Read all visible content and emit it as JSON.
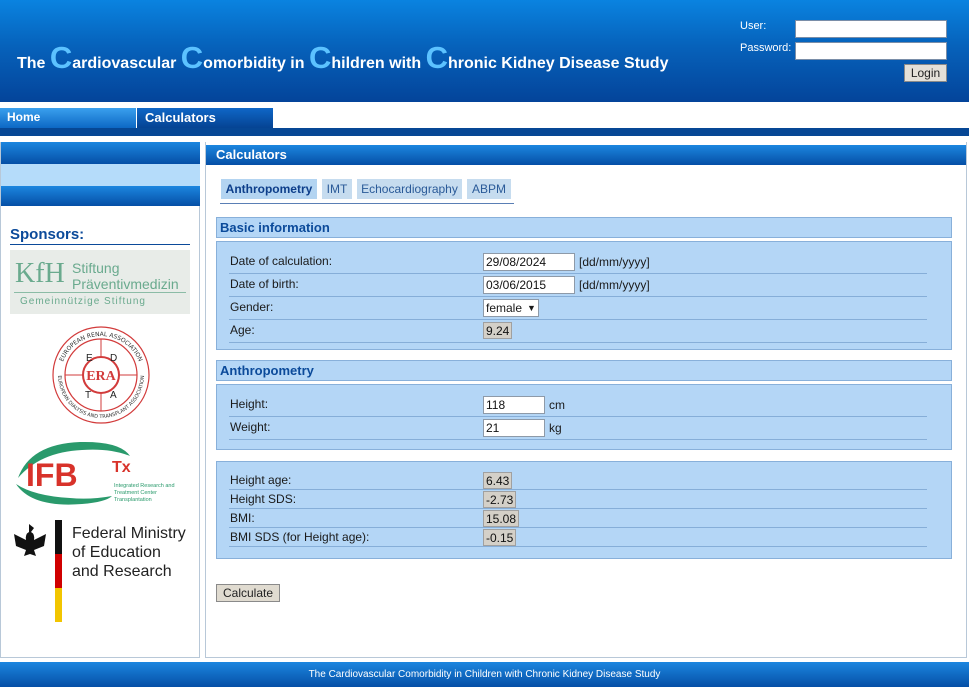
{
  "header": {
    "title_parts": {
      "p1": "The ",
      "c1": "C",
      "p2": "ardiovascular ",
      "c2": "C",
      "p3": "omorbidity in ",
      "c3": "C",
      "p4": "hildren with ",
      "c4": "C",
      "p5": "hronic Kidney Disease Study"
    },
    "user_label": "User:",
    "password_label": "Password:",
    "user_value": "",
    "password_value": "",
    "login_label": "Login"
  },
  "nav": {
    "home": "Home",
    "calculators": "Calculators"
  },
  "sidebar": {
    "sponsors_title": "Sponsors:",
    "kfh": {
      "mark": "KfH",
      "line1": "Stiftung",
      "line2": "Präventivmedizin",
      "line3": "Gemeinnützige Stiftung"
    },
    "era": {
      "ring_top": "EUROPEAN RENAL ASSOCIATION",
      "ring_bottom": "EUROPEAN DIALYSIS AND TRANSPLANT ASSOCIATION",
      "center": "ERA",
      "letters": [
        "E",
        "D",
        "T",
        "A"
      ]
    },
    "ifb": {
      "mark": "IFB",
      "sub": "Tx",
      "line1": "Integrated Research and",
      "line2": "Treatment Center",
      "line3": "Transplantation"
    },
    "bmbf": {
      "line1": "Federal Ministry",
      "line2": "of Education",
      "line3": "and Research"
    }
  },
  "main": {
    "title": "Calculators",
    "tabs": [
      {
        "label": "Anthropometry",
        "active": true
      },
      {
        "label": "IMT",
        "active": false
      },
      {
        "label": "Echocardiography",
        "active": false
      },
      {
        "label": "ABPM",
        "active": false
      }
    ],
    "basic": {
      "title": "Basic information",
      "date_calc_label": "Date of calculation:",
      "date_calc_value": "29/08/2024",
      "date_calc_unit": "[dd/mm/yyyy]",
      "dob_label": "Date of birth:",
      "dob_value": "03/06/2015",
      "dob_unit": "[dd/mm/yyyy]",
      "gender_label": "Gender:",
      "gender_value": "female",
      "age_label": "Age:",
      "age_value": "9.24"
    },
    "anthro": {
      "title": "Anthropometry",
      "height_label": "Height:",
      "height_value": "118",
      "height_unit": "cm",
      "weight_label": "Weight:",
      "weight_value": "21",
      "weight_unit": "kg"
    },
    "results": {
      "height_age_label": "Height age:",
      "height_age_value": "6.43",
      "height_sds_label": "Height SDS:",
      "height_sds_value": "-2.73",
      "bmi_label": "BMI:",
      "bmi_value": "15.08",
      "bmi_sds_label": "BMI SDS (for Height age):",
      "bmi_sds_value": "-0.15"
    },
    "calculate_label": "Calculate"
  },
  "footer": {
    "text": "The Cardiovascular Comorbidity in Children with Chronic Kidney Disease Study"
  },
  "colors": {
    "brand_blue": "#0662bb",
    "accent_light_blue": "#5cc2ff",
    "section_bg": "#b4d6f6",
    "heading_text": "#0b4a9a"
  }
}
